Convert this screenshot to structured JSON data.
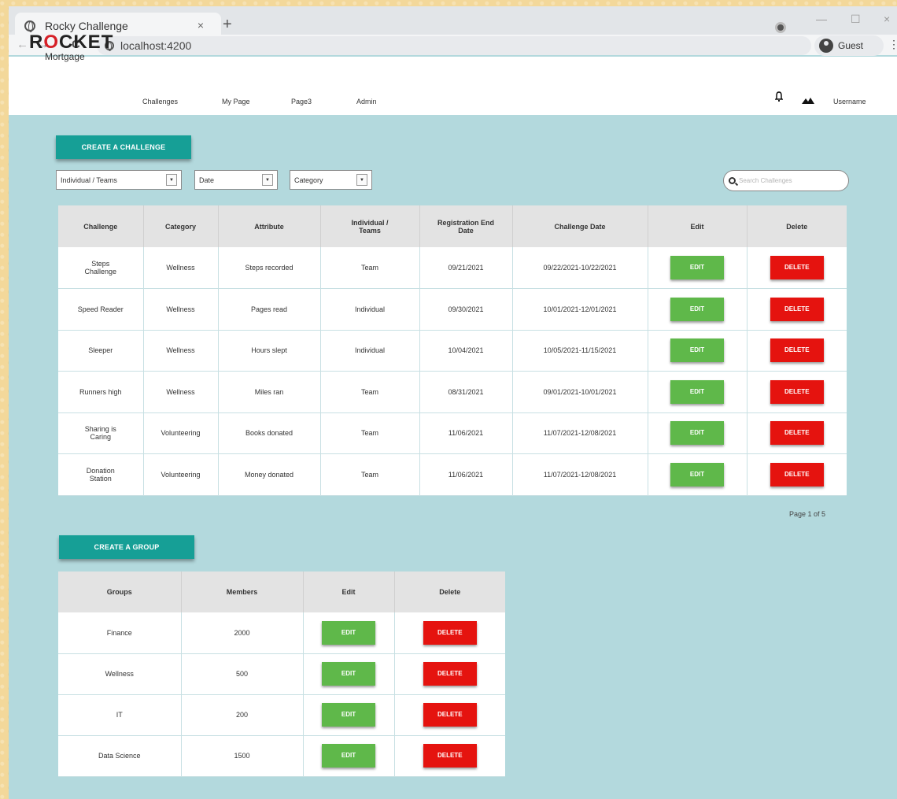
{
  "browser": {
    "tab_title": "Rocky Challenge",
    "tab_close": "×",
    "new_tab": "+",
    "url": "localhost:4200",
    "profile_label": "Guest",
    "menu": "⋮",
    "win_minimize": "—",
    "win_maximize": "☐",
    "win_close": "×",
    "back": "←",
    "forward": "→",
    "reload": "C"
  },
  "header": {
    "logo_top_pre": "R",
    "logo_top_o": "O",
    "logo_top_post": "CKET",
    "logo_sub": "Mortgage",
    "nav": [
      "Challenges",
      "My Page",
      "Page3",
      "Admin"
    ],
    "bell": "♫",
    "mountain": "▲",
    "username": "Username"
  },
  "challenges": {
    "create_label": "CREATE A CHALLENGE",
    "filters": [
      "Individual / Teams",
      "Date",
      "Category"
    ],
    "filter_arrow": "▼",
    "search_placeholder": "Search Challenges",
    "columns": [
      "Challenge",
      "Category",
      "Attribute",
      "Individual / Teams",
      "Registration End Date",
      "Challenge Date",
      "Edit",
      "Delete"
    ],
    "rows": [
      {
        "challenge": "Steps Challenge",
        "category": "Wellness",
        "attribute": "Steps recorded",
        "type": "Team",
        "reg_end": "09/21/2021",
        "dates": "09/22/2021-10/22/2021"
      },
      {
        "challenge": "Speed Reader",
        "category": "Wellness",
        "attribute": "Pages read",
        "type": "Individual",
        "reg_end": "09/30/2021",
        "dates": "10/01/2021-12/01/2021"
      },
      {
        "challenge": "Sleeper",
        "category": "Wellness",
        "attribute": "Hours slept",
        "type": "Individual",
        "reg_end": "10/04/2021",
        "dates": "10/05/2021-11/15/2021"
      },
      {
        "challenge": "Runners high",
        "category": "Wellness",
        "attribute": "Miles ran",
        "type": "Team",
        "reg_end": "08/31/2021",
        "dates": "09/01/2021-10/01/2021"
      },
      {
        "challenge": "Sharing is Caring",
        "category": "Volunteering",
        "attribute": "Books donated",
        "type": "Team",
        "reg_end": "11/06/2021",
        "dates": "11/07/2021-12/08/2021"
      },
      {
        "challenge": "Donation Station",
        "category": "Volunteering",
        "attribute": "Money donated",
        "type": "Team",
        "reg_end": "11/06/2021",
        "dates": "11/07/2021-12/08/2021"
      }
    ],
    "edit_label": "EDIT",
    "delete_label": "DELETE",
    "pagination": "Page 1 of 5"
  },
  "groups": {
    "create_label": "CREATE A GROUP",
    "columns": [
      "Groups",
      "Members",
      "Edit",
      "Delete"
    ],
    "rows": [
      {
        "group": "Finance",
        "members": "2000"
      },
      {
        "group": "Wellness",
        "members": "500"
      },
      {
        "group": "IT",
        "members": "200"
      },
      {
        "group": "Data Science",
        "members": "1500"
      }
    ],
    "edit_label": "EDIT",
    "delete_label": "DELETE"
  },
  "colors": {
    "page_bg": "#b3d9dd",
    "teal": "#169f96",
    "edit_green": "#5fb84a",
    "delete_red": "#e5130f",
    "logo_red": "#d62027"
  }
}
